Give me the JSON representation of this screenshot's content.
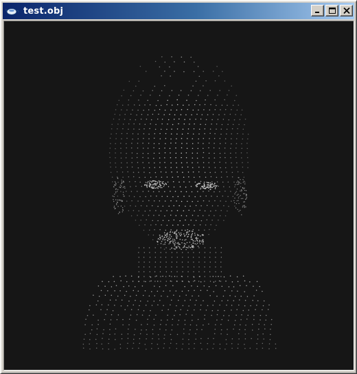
{
  "window": {
    "title": "test.obj",
    "app_icon": "teapot-icon",
    "controls": {
      "minimize_icon": "minimize-icon",
      "maximize_icon": "maximize-icon",
      "close_icon": "close-icon"
    }
  },
  "viewport": {
    "content": "point-cloud-head-model",
    "background": "#161616",
    "point_color": "#d8d8d8"
  }
}
